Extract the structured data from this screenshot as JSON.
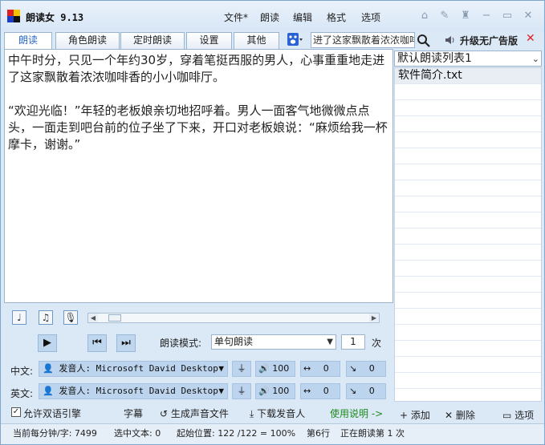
{
  "app": {
    "title": "朗读女 9.13"
  },
  "menu": [
    "文件*",
    "朗读",
    "编辑",
    "格式",
    "选项"
  ],
  "tabs": [
    "朗读",
    "角色朗读",
    "定时朗读",
    "设置",
    "其他"
  ],
  "search": {
    "value": "进了这家飘散着浓浓咖啡"
  },
  "upgrade_label": "升级无广告版",
  "editor": {
    "paragraphs": [
      "中午时分，只见一个年约30岁，穿着笔挺西服的男人，心事重重地走进了这家飘散着浓浓咖啡香的小小咖啡厅。",
      "“欢迎光临！”年轻的老板娘亲切地招呼着。男人一面客气地微微点点头，一面走到吧台前的位子坐了下来，开口对老板娘说：“麻烦给我一杯摩卡，谢谢。”"
    ]
  },
  "playlist": {
    "selected": "默认朗读列表1",
    "items": [
      "软件简介.txt"
    ],
    "add": "添加",
    "delete": "删除",
    "options": "选项"
  },
  "controls": {
    "mode_label": "朗读模式:",
    "mode_value": "单句朗读",
    "repeat_value": "1",
    "repeat_unit": "次",
    "chinese": {
      "label": "中文:",
      "voice": "发音人: Microsoft David Desktop",
      "volume": "100",
      "speed": "0",
      "pitch": "0"
    },
    "english": {
      "label": "英文:",
      "voice": "发音人: Microsoft David Desktop",
      "volume": "100",
      "speed": "0",
      "pitch": "0"
    },
    "allow_bilingual": "允许双语引擎",
    "subtitle": "字幕",
    "generate_audio": "生成声音文件",
    "download_voice": "下载发音人",
    "usage": "使用说明 ->"
  },
  "status": {
    "avg": "当前每分钟/字: 7499",
    "selected": "选中文本: 0",
    "start": "起始位置: 122 /122 = 100%",
    "line": "第6行",
    "reading": "正在朗读第 1 次"
  },
  "colors": {
    "accent": "#2a6bc0",
    "close": "#dd2222",
    "green": "#1d8a1d"
  }
}
